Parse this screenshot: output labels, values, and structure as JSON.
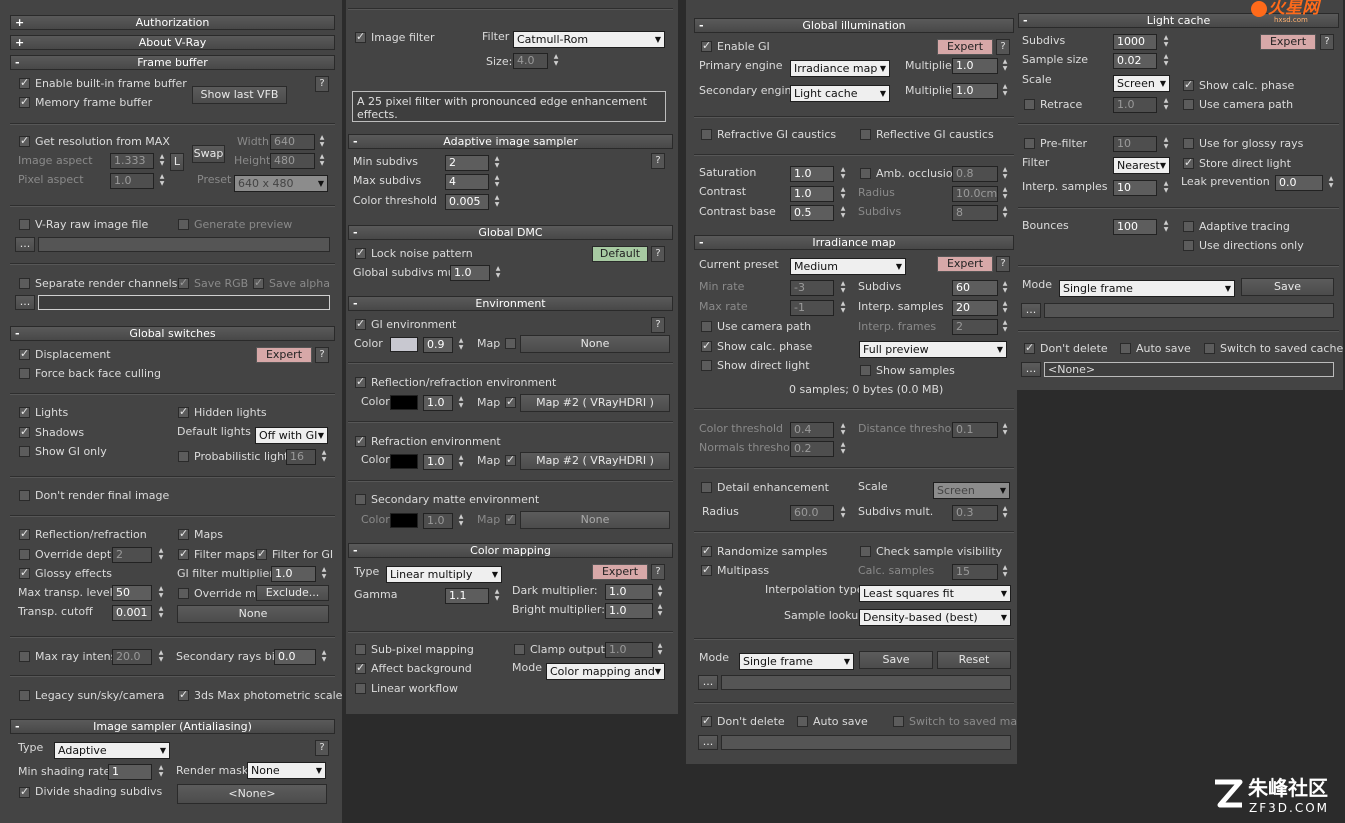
{
  "col1": {
    "authorization": "Authorization",
    "about": "About V-Ray",
    "frame_buffer": "Frame buffer",
    "enable_vfb": "Enable built-in frame buffer",
    "memory_fb": "Memory frame buffer",
    "show_last_vfb": "Show last VFB",
    "get_res": "Get resolution from MAX",
    "width_lbl": "Width",
    "width_val": "640",
    "swap": "Swap",
    "image_aspect_lbl": "Image aspect",
    "image_aspect_val": "1.333",
    "lock": "L",
    "height_lbl": "Height",
    "height_val": "480",
    "pixel_aspect_lbl": "Pixel aspect",
    "pixel_aspect_val": "1.0",
    "preset_lbl": "Preset",
    "preset_val": "640 x 480",
    "raw_image": "V-Ray raw image file",
    "gen_preview": "Generate preview",
    "browse": "...",
    "sep_channels": "Separate render channels",
    "save_rgb": "Save RGB",
    "save_alpha": "Save alpha",
    "global_switches": "Global switches",
    "displacement": "Displacement",
    "expert": "Expert",
    "force_back": "Force back face culling",
    "lights": "Lights",
    "hidden_lights": "Hidden lights",
    "shadows": "Shadows",
    "default_lights_lbl": "Default lights",
    "default_lights_val": "Off with GI",
    "show_gi_only": "Show GI only",
    "prob_lights": "Probabilistic lights",
    "prob_lights_val": "16",
    "dont_render": "Don't render final image",
    "refl_refr": "Reflection/refraction",
    "maps": "Maps",
    "override_depth": "Override depth",
    "override_depth_val": "2",
    "filter_maps": "Filter maps",
    "filter_gi": "Filter for GI",
    "glossy": "Glossy effects",
    "gi_filter_mult": "GI filter multiplier",
    "gi_filter_mult_val": "1.0",
    "max_transp": "Max transp. levels",
    "max_transp_val": "50",
    "override_mtl": "Override mtl",
    "exclude": "Exclude...",
    "transp_cutoff": "Transp. cutoff",
    "transp_cutoff_val": "0.001",
    "none": "None",
    "max_ray": "Max ray intens",
    "max_ray_val": "20.0",
    "sec_bias": "Secondary rays bias",
    "sec_bias_val": "0.0",
    "legacy_sun": "Legacy sun/sky/camera",
    "photometric": "3ds Max photometric scale",
    "image_sampler": "Image sampler (Antialiasing)",
    "type_lbl": "Type",
    "type_val": "Adaptive",
    "min_shading": "Min shading rate",
    "min_shading_val": "1",
    "render_mask": "Render mask",
    "render_mask_val": "None",
    "divide_shading": "Divide shading subdivs",
    "none_bracket": "<None>"
  },
  "col2": {
    "image_filter": "Image filter",
    "filter_lbl": "Filter",
    "filter_val": "Catmull-Rom",
    "size_lbl": "Size:",
    "size_val": "4.0",
    "filter_desc": "A 25 pixel filter with pronounced edge enhancement effects.",
    "adaptive": "Adaptive image sampler",
    "min_subdivs": "Min subdivs",
    "min_subdivs_val": "2",
    "max_subdivs": "Max subdivs",
    "max_subdivs_val": "4",
    "color_threshold": "Color threshold",
    "color_threshold_val": "0.005",
    "global_dmc": "Global DMC",
    "lock_noise": "Lock noise pattern",
    "default": "Default",
    "global_subdivs": "Global subdivs mult.",
    "global_subdivs_val": "1.0",
    "environment": "Environment",
    "gi_env": "GI environment",
    "color_lbl": "Color",
    "gi_mult": "0.9",
    "map_lbl": "Map",
    "none": "None",
    "refl_env": "Reflection/refraction environment",
    "refl_mult": "1.0",
    "map2": "Map #2  ( VRayHDRI )",
    "refr_env": "Refraction environment",
    "refr_mult": "1.0",
    "sec_matte": "Secondary matte environment",
    "sec_mult": "1.0",
    "color_mapping": "Color mapping",
    "type_lbl": "Type",
    "type_val": "Linear multiply",
    "expert": "Expert",
    "gamma_lbl": "Gamma",
    "gamma_val": "1.1",
    "dark_mult": "Dark multiplier:",
    "dark_mult_val": "1.0",
    "bright_mult": "Bright multiplier:",
    "bright_mult_val": "1.0",
    "subpixel": "Sub-pixel mapping",
    "clamp": "Clamp output",
    "clamp_val": "1.0",
    "affect_bg": "Affect background",
    "mode_lbl": "Mode",
    "mode_val": "Color mapping and g",
    "linear_wf": "Linear workflow"
  },
  "col3": {
    "global_illum": "Global illumination",
    "enable_gi": "Enable GI",
    "expert": "Expert",
    "primary_engine": "Primary engine",
    "primary_val": "Irradiance map",
    "multiplier": "Multiplier",
    "prim_mult": "1.0",
    "secondary_engine": "Secondary engine",
    "secondary_val": "Light cache",
    "sec_mult": "1.0",
    "refr_caustics": "Refractive GI caustics",
    "refl_caustics": "Reflective GI caustics",
    "saturation": "Saturation",
    "saturation_val": "1.0",
    "amb_occ": "Amb. occlusion",
    "amb_occ_val": "0.8",
    "contrast": "Contrast",
    "contrast_val": "1.0",
    "radius": "Radius",
    "radius_val": "10.0cm",
    "contrast_base": "Contrast base",
    "contrast_base_val": "0.5",
    "subdivs": "Subdivs",
    "subdivs_val": "8",
    "irr_map": "Irradiance map",
    "current_preset": "Current preset",
    "preset_val": "Medium",
    "min_rate": "Min rate",
    "min_rate_val": "-3",
    "im_subdivs_val": "60",
    "max_rate": "Max rate",
    "max_rate_val": "-1",
    "interp_samples": "Interp. samples",
    "interp_samples_val": "20",
    "use_cam_path": "Use camera path",
    "interp_frames": "Interp. frames",
    "interp_frames_val": "2",
    "show_calc": "Show calc. phase",
    "preview_val": "Full preview",
    "show_direct": "Show direct light",
    "show_samples": "Show samples",
    "samples_info": "0 samples; 0 bytes (0.0 MB)",
    "color_thresh": "Color threshold",
    "color_thresh_val": "0.4",
    "dist_thresh": "Distance threshold",
    "dist_thresh_val": "0.1",
    "normals_thresh": "Normals threshold",
    "normals_thresh_val": "0.2",
    "detail_enh": "Detail enhancement",
    "scale_lbl": "Scale",
    "scale_val": "Screen",
    "radius_val2": "60.0",
    "subdivs_mult": "Subdivs mult.",
    "subdivs_mult_val": "0.3",
    "randomize": "Randomize samples",
    "check_vis": "Check sample visibility",
    "multipass": "Multipass",
    "calc_samples": "Calc. samples",
    "calc_samples_val": "15",
    "interp_type": "Interpolation type",
    "interp_type_val": "Least squares fit (good/smo",
    "sample_lookup": "Sample lookup",
    "sample_lookup_val": "Density-based (best)",
    "mode_lbl": "Mode",
    "mode_val": "Single frame",
    "save": "Save",
    "reset": "Reset",
    "browse": "...",
    "dont_delete": "Don't delete",
    "auto_save": "Auto save",
    "switch_saved": "Switch to saved map"
  },
  "col4": {
    "light_cache": "Light cache",
    "subdivs": "Subdivs",
    "subdivs_val": "1000",
    "expert": "Expert",
    "sample_size": "Sample size",
    "sample_size_val": "0.02",
    "scale": "Scale",
    "scale_val": "Screen",
    "show_calc": "Show calc. phase",
    "retrace": "Retrace",
    "retrace_val": "1.0",
    "use_cam_path": "Use camera path",
    "prefilter": "Pre-filter",
    "prefilter_val": "10",
    "use_glossy": "Use for glossy rays",
    "filter": "Filter",
    "filter_val": "Nearest",
    "store_direct": "Store direct light",
    "interp_samples": "Interp. samples",
    "interp_samples_val": "10",
    "leak": "Leak prevention",
    "leak_val": "0.0",
    "bounces": "Bounces",
    "bounces_val": "100",
    "adaptive": "Adaptive tracing",
    "use_dirs": "Use directions only",
    "mode_lbl": "Mode",
    "mode_val": "Single frame",
    "save": "Save",
    "browse": "...",
    "dont_delete": "Don't delete",
    "auto_save": "Auto save",
    "switch_saved": "Switch to saved cache",
    "none_bracket": "<None>"
  },
  "watermarks": {
    "top_text": "火星网",
    "top_sub": "hxsd.com",
    "bottom_cn": "朱峰社区",
    "bottom_en": "ZF3D.COM"
  }
}
